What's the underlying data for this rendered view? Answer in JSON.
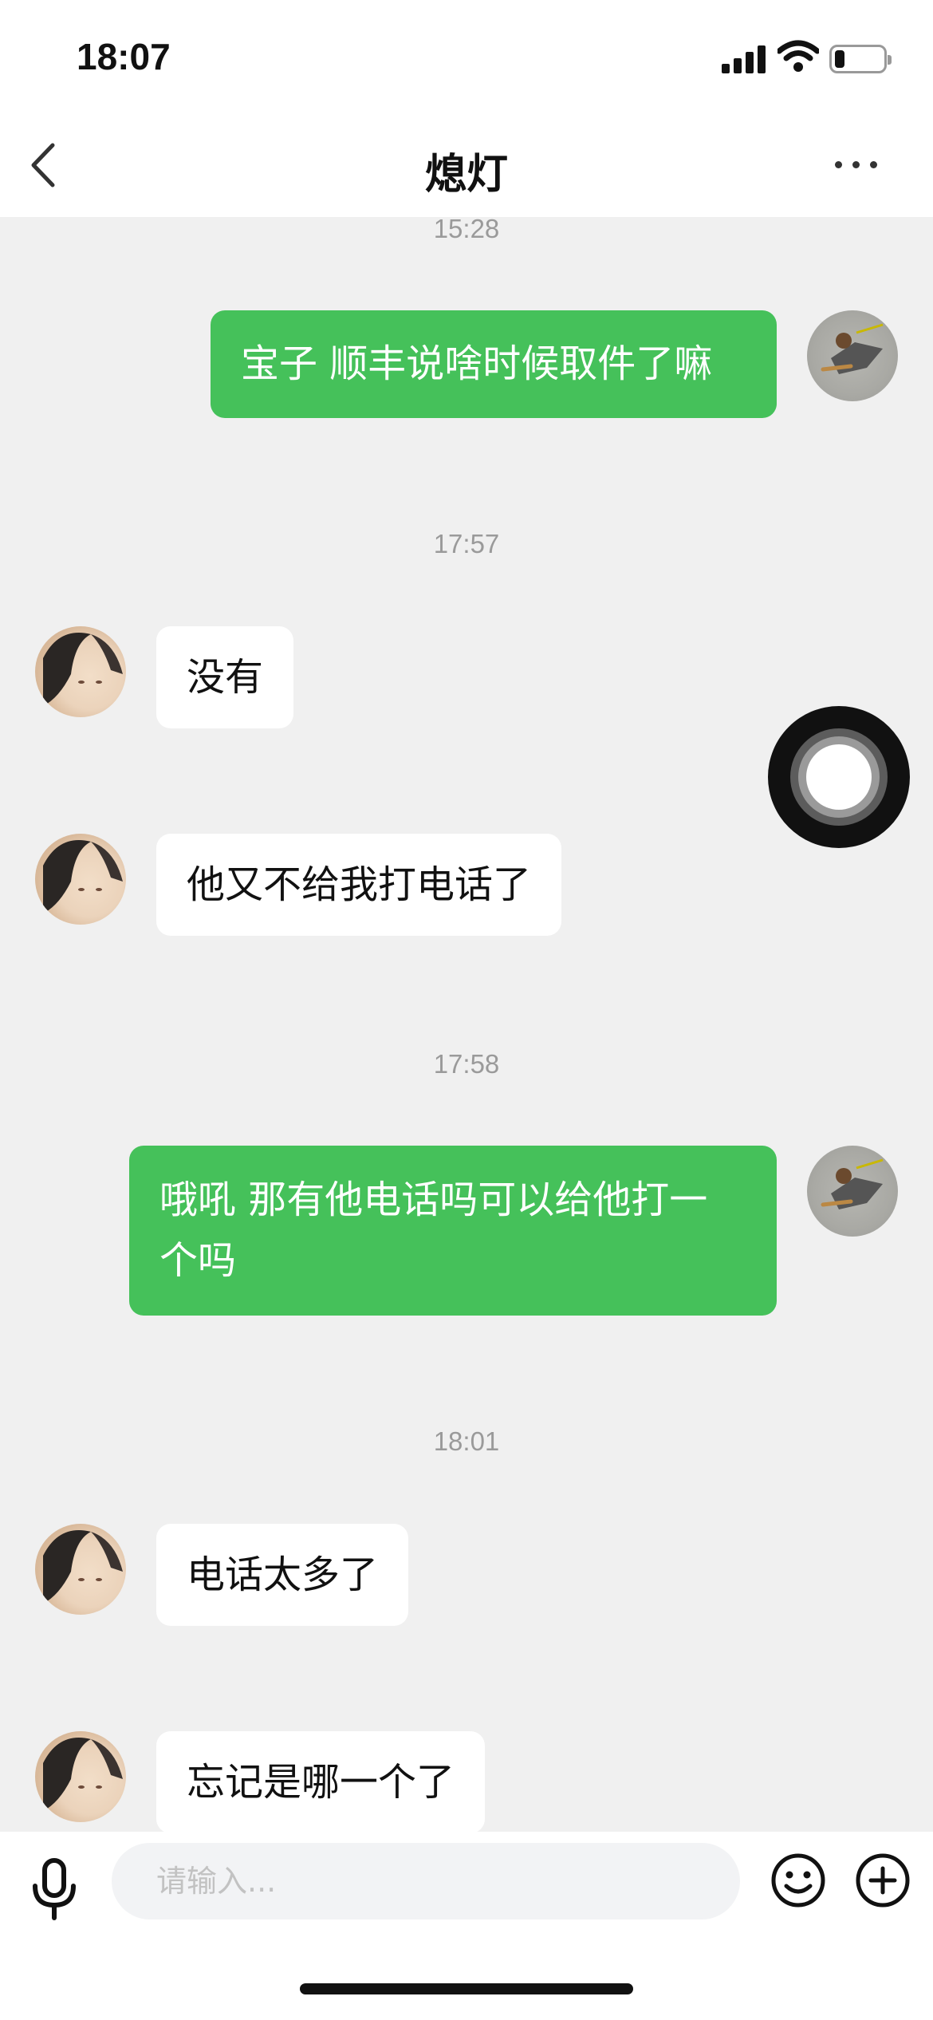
{
  "status_bar": {
    "time": "18:07",
    "battery_level": 0.2
  },
  "header": {
    "back_icon": "chevron-left-icon",
    "title": "熄灯",
    "more_icon": "more-dots-icon"
  },
  "messages": [
    {
      "type": "time",
      "text": "15:28"
    },
    {
      "type": "out",
      "text": "宝子 顺丰说啥时候取件了嘛"
    },
    {
      "type": "time",
      "text": "17:57"
    },
    {
      "type": "in",
      "text": "没有"
    },
    {
      "type": "in",
      "text": "他又不给我打电话了"
    },
    {
      "type": "time",
      "text": "17:58"
    },
    {
      "type": "out",
      "line1": "哦吼 那有他电话吗可以给他打一",
      "line2": "个吗"
    },
    {
      "type": "time",
      "text": "18:01"
    },
    {
      "type": "in",
      "text": "电话太多了"
    },
    {
      "type": "in",
      "text": "忘记是哪一个了"
    }
  ],
  "composer": {
    "placeholder": "请输入...",
    "voice_icon": "microphone-icon",
    "emoji_icon": "emoji-smile-icon",
    "plus_icon": "plus-circle-icon"
  },
  "colors": {
    "outgoing_bubble": "#45c15a",
    "incoming_bubble": "#ffffff",
    "chat_background": "#f0f0f0"
  }
}
